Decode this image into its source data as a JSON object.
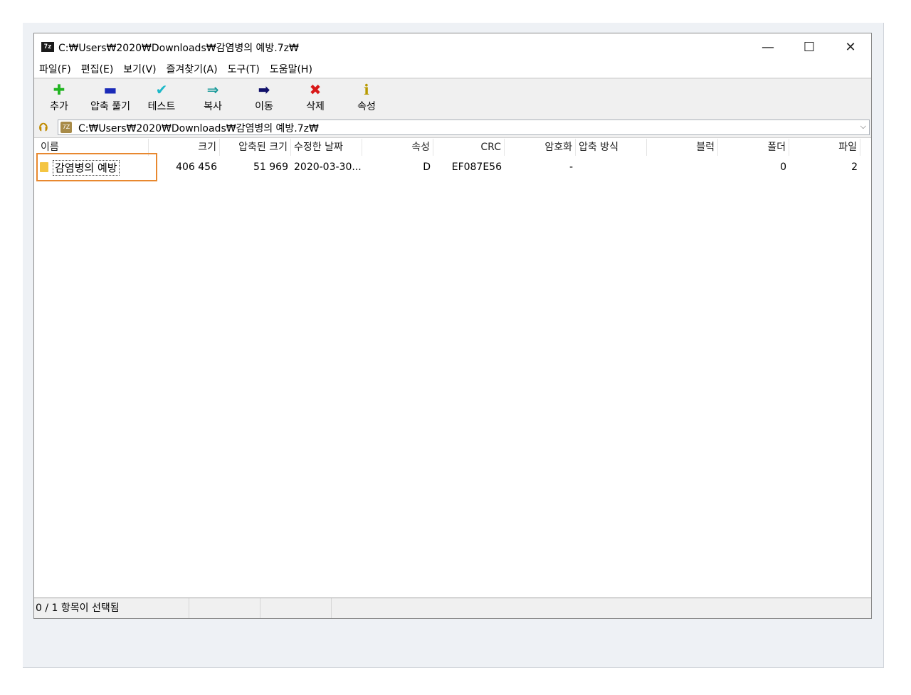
{
  "window": {
    "title": "C:₩Users₩2020₩Downloads₩감염병의 예방.7z₩",
    "app_icon_text": "7z",
    "controls": {
      "minimize": "—",
      "maximize": "☐",
      "close": "✕"
    }
  },
  "menu": [
    "파일(F)",
    "편집(E)",
    "보기(V)",
    "즐겨찾기(A)",
    "도구(T)",
    "도움말(H)"
  ],
  "toolbar": [
    {
      "label": "추가",
      "icon": "plus-icon",
      "glyph": "✚",
      "color": "#22b522"
    },
    {
      "label": "압축 풀기",
      "icon": "minus-icon",
      "glyph": "▬",
      "color": "#1a2ab8"
    },
    {
      "label": "테스트",
      "icon": "check-icon",
      "glyph": "✔",
      "color": "#1cb8c8"
    },
    {
      "label": "복사",
      "icon": "copy-arrow-icon",
      "glyph": "⇒",
      "color": "#1a9a9a"
    },
    {
      "label": "이동",
      "icon": "move-arrow-icon",
      "glyph": "➡",
      "color": "#10106a"
    },
    {
      "label": "삭제",
      "icon": "delete-x-icon",
      "glyph": "✖",
      "color": "#d81818"
    },
    {
      "label": "속성",
      "icon": "info-icon",
      "glyph": "ℹ",
      "color": "#b89a00"
    }
  ],
  "address": {
    "path": "C:₩Users₩2020₩Downloads₩감염병의 예방.7z₩",
    "up_glyph": "⮉",
    "icon_text": "7Z",
    "dropdown_glyph": "⌵"
  },
  "columns": [
    "이름",
    "크기",
    "압축된 크기",
    "수정한 날짜",
    "속성",
    "CRC",
    "암호화",
    "압축 방식",
    "블럭",
    "폴더",
    "파일"
  ],
  "rows": [
    {
      "name": "감염병의 예방",
      "size": "406 456",
      "packed": "51 969",
      "modified": "2020-03-30...",
      "attr": "D",
      "crc": "EF087E56",
      "encrypted": "-",
      "method": "",
      "block": "",
      "folders": "0",
      "files": "2"
    }
  ],
  "status": {
    "selection": "0 / 1 항목이 선택됨",
    "pane2": "",
    "pane3": ""
  },
  "colors": {
    "highlight": "#e8882f",
    "folder": "#f4c542"
  }
}
